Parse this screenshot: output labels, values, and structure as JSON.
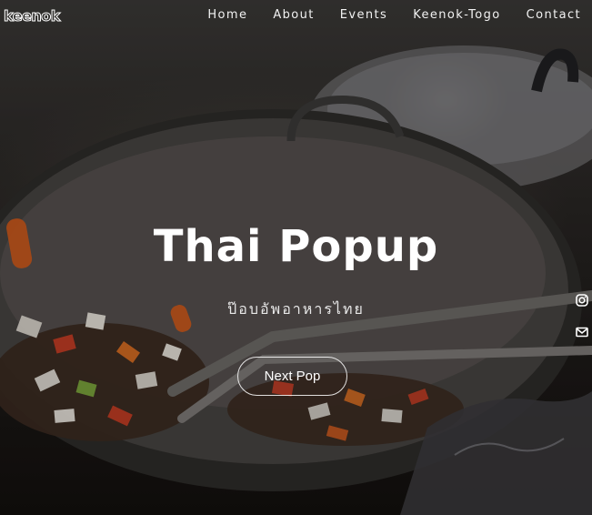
{
  "header": {
    "logo_text": "keenok",
    "nav": [
      {
        "label": "Home",
        "icon": ""
      },
      {
        "label": "About",
        "icon": ""
      },
      {
        "label": "Events",
        "icon": ""
      },
      {
        "label": "Keenok-Togo",
        "icon": ""
      },
      {
        "label": "Contact",
        "icon": ""
      }
    ]
  },
  "hero": {
    "title": "Thai Popup",
    "subtitle": "ป๊อบอัพอาหารไทย",
    "cta_label": "Next Pop",
    "background_icon": "wok-cooking-photo"
  },
  "social": [
    {
      "icon": "instagram-icon"
    },
    {
      "icon": "mail-icon"
    }
  ],
  "colors": {
    "text": "#ffffff",
    "button_border": "#ffffff"
  }
}
